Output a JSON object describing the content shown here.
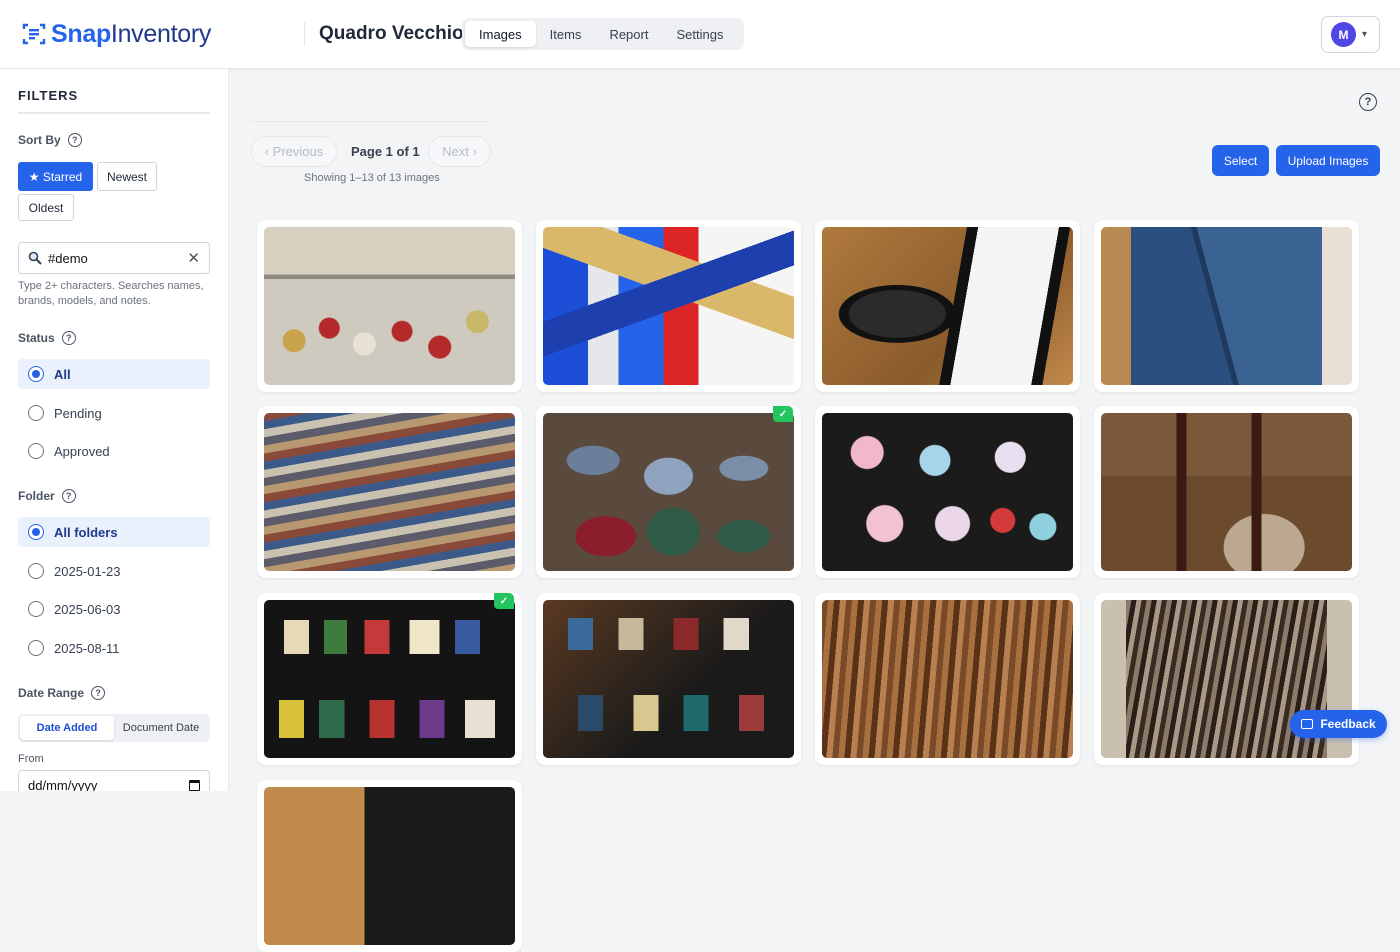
{
  "header": {
    "logo_snap": "Snap",
    "logo_rest": "Inventory",
    "project_name": "Quadro Vecchio",
    "tabs": [
      "Images",
      "Items",
      "Report",
      "Settings"
    ],
    "active_tab": "Images",
    "user_initial": "M",
    "caret": "▾"
  },
  "sidebar": {
    "title": "FILTERS",
    "sort": {
      "label": "Sort By",
      "starred": "★ Starred",
      "newest": "Newest",
      "oldest": "Oldest",
      "active": "Starred"
    },
    "search": {
      "value": "#demo",
      "clear": "✕",
      "hint": "Type 2+ characters. Searches names, brands, models, and notes."
    },
    "status": {
      "label": "Status",
      "options": [
        "All",
        "Pending",
        "Approved"
      ],
      "selected": "All"
    },
    "folder": {
      "label": "Folder",
      "options": [
        "All folders",
        "2025-01-23",
        "2025-06-03",
        "2025-08-11"
      ],
      "selected": "All folders"
    },
    "date_range": {
      "label": "Date Range",
      "modes": [
        "Date Added",
        "Document Date"
      ],
      "active_mode": "Date Added",
      "from_label": "From",
      "from_placeholder": "dd/mm/yyyy"
    }
  },
  "main": {
    "help": "?",
    "pager": {
      "previous": "‹ Previous",
      "next": "Next ›",
      "page_info": "Page 1 of 1",
      "showing": "Showing 1–13 of 13 images"
    },
    "select_button": "Select",
    "upload_button": "Upload Images",
    "checkmark": "✓",
    "feedback": "Feedback"
  },
  "colors": {
    "primary": "#2563eb",
    "approved_badge": "#22c55e",
    "selected_bg": "#eaf1fd"
  },
  "icons": {
    "logo": "scan-icon",
    "search": "magnifier-icon",
    "help": "question-circle-icon",
    "feedback": "chat-bubble-icon",
    "calendar": "calendar-icon"
  }
}
